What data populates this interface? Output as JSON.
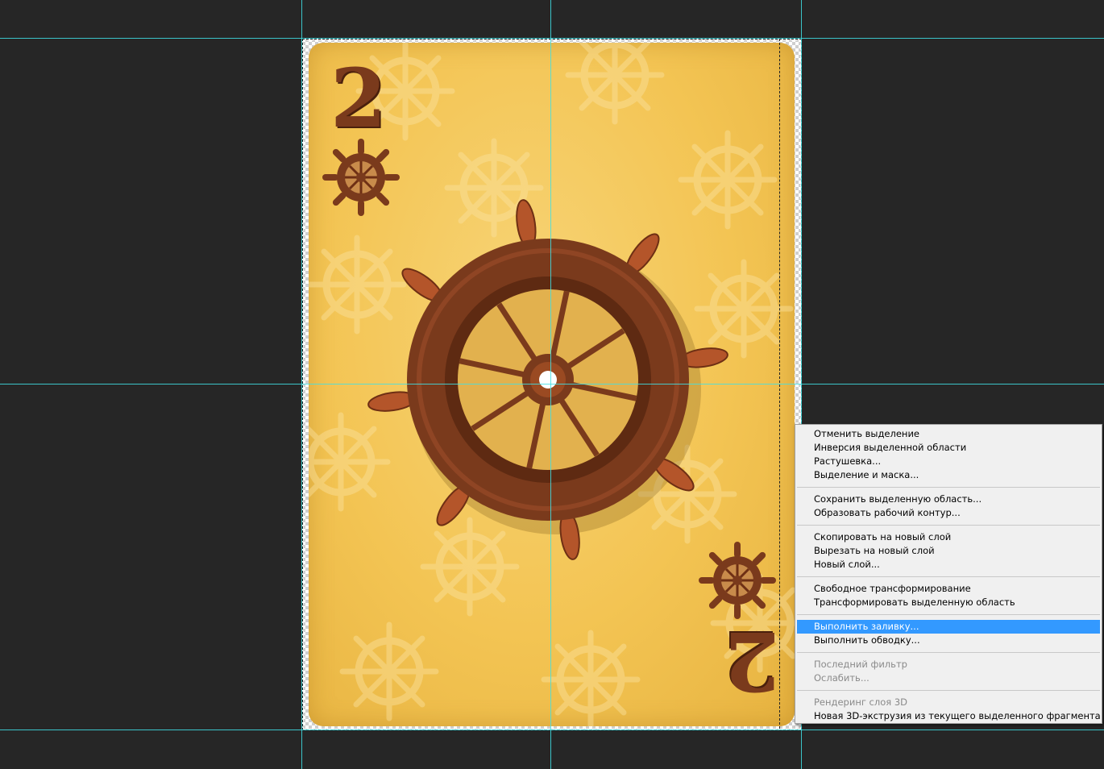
{
  "document": {
    "card_rank_top": "2",
    "card_rank_bottom": "2"
  },
  "colors": {
    "card_yellow": "#f3c453",
    "wheel_brown": "#7a3a1c",
    "guide_cyan": "#3fe0e6",
    "menu_highlight": "#3399ff",
    "workspace": "#262626"
  },
  "context_menu": {
    "groups": [
      [
        {
          "label": "Отменить выделение",
          "enabled": true
        },
        {
          "label": "Инверсия выделенной области",
          "enabled": true
        },
        {
          "label": "Растушевка...",
          "enabled": true
        },
        {
          "label": "Выделение и маска...",
          "enabled": true
        }
      ],
      [
        {
          "label": "Сохранить выделенную область...",
          "enabled": true
        },
        {
          "label": "Образовать рабочий контур...",
          "enabled": true
        }
      ],
      [
        {
          "label": "Скопировать на новый слой",
          "enabled": true
        },
        {
          "label": "Вырезать на новый слой",
          "enabled": true
        },
        {
          "label": "Новый слой...",
          "enabled": true
        }
      ],
      [
        {
          "label": "Свободное трансформирование",
          "enabled": true
        },
        {
          "label": "Трансформировать выделенную область",
          "enabled": true
        }
      ],
      [
        {
          "label": "Выполнить заливку...",
          "enabled": true,
          "highlighted": true
        },
        {
          "label": "Выполнить обводку...",
          "enabled": true
        }
      ],
      [
        {
          "label": "Последний фильтр",
          "enabled": false
        },
        {
          "label": "Ослабить...",
          "enabled": false
        }
      ],
      [
        {
          "label": "Рендеринг слоя 3D",
          "enabled": false
        },
        {
          "label": "Новая 3D-экструзия из текущего выделенного фрагмента",
          "enabled": true
        }
      ]
    ]
  }
}
